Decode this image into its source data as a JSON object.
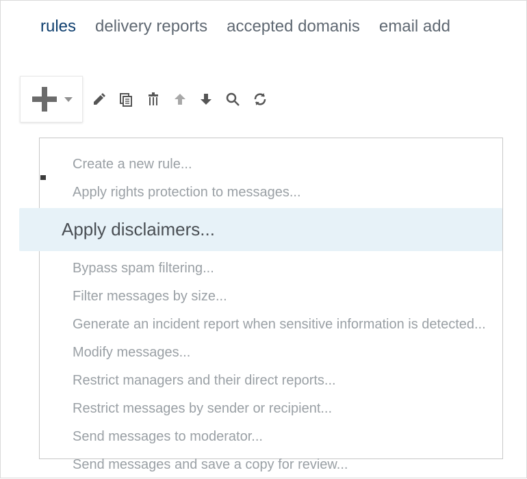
{
  "tabs": {
    "rules": "rules",
    "delivery_reports": "delivery reports",
    "accepted_domains": "accepted domanis",
    "email_add": "email add"
  },
  "menu": {
    "item0": "Create a new rule...",
    "item1": "Apply rights protection to messages...",
    "item2": "Apply disclaimers...",
    "item3": "Bypass spam filtering...",
    "item4": "Filter messages by size...",
    "item5": "Generate an incident report when sensitive information is detected...",
    "item6": "Modify messages...",
    "item7": "Restrict managers and their direct reports...",
    "item8": "Restrict messages by sender or recipient...",
    "item9": "Send messages to moderator...",
    "item10": "Send messages and save a copy for review..."
  }
}
